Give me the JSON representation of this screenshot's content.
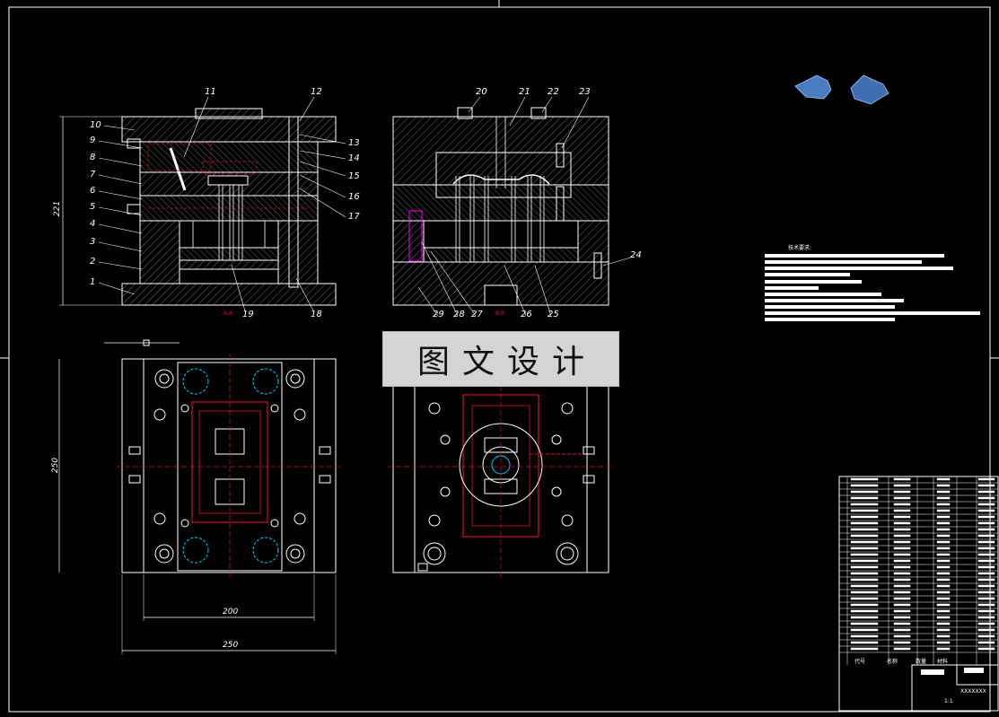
{
  "drawing": {
    "watermark": "图文设计",
    "technical_requirements_title": "技术要求:",
    "views": {
      "section_a": "A-A",
      "section_b": "B-B"
    },
    "part_labels_left": [
      "1",
      "2",
      "3",
      "4",
      "5",
      "6",
      "7",
      "8",
      "9",
      "10",
      "11",
      "12",
      "13",
      "14",
      "15",
      "16",
      "17",
      "18",
      "19"
    ],
    "part_labels_right": [
      "20",
      "21",
      "22",
      "23",
      "24",
      "25",
      "26",
      "27",
      "28",
      "29"
    ],
    "dimensions": {
      "height": "221",
      "plate_side": "250",
      "width_inner": "200",
      "width_outer": "250"
    },
    "title_block": {
      "code_col": "代号",
      "name_col": "名称",
      "qty_col": "数量",
      "material_col": "材料",
      "drawing_no": "XXXXXXX",
      "scale": "1:1"
    }
  },
  "colors": {
    "background": "#000000",
    "line": "#ffffff",
    "hidden": "#d01030",
    "accent_cyan": "#00d0ff",
    "accent_magenta": "#ff00ff",
    "watermark_bg": "#d4d4d4"
  }
}
